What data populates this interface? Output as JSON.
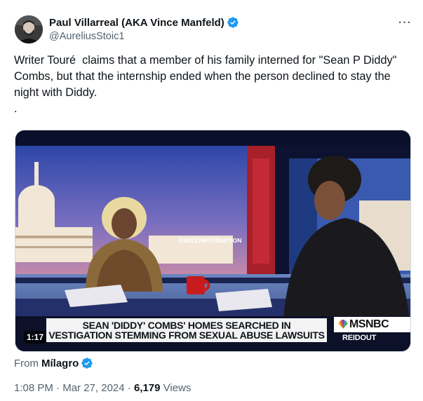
{
  "author": {
    "display_name": "Paul Villarreal (AKA Vince Manfeld)",
    "handle": "@AureliusStoic1",
    "verified_icon": "verified-badge-icon"
  },
  "more_icon": "more-options-icon",
  "tweet": {
    "text": "Writer Touré  claims that a member of his family interned for \"Sean P Diddy\" Combs, but that the internship ended when the person declined to stay the night with Diddy.\n."
  },
  "video": {
    "duration": "1:17",
    "watermark": "@MIZZINFORMATION",
    "chyron_line1": "SEAN 'DIDDY' COMBS' HOMES SEARCHED IN",
    "chyron_line2": "VESTIGATION STEMMING FROM SEXUAL ABUSE LAWSUITS",
    "network_logo": "MSNBC",
    "show_tag": "REIDOUT"
  },
  "source": {
    "label": "From",
    "name": "Mílagro"
  },
  "meta": {
    "time": "1:08 PM",
    "separator1": " · ",
    "date": "Mar 27, 2024",
    "separator2": " · ",
    "views_count": "6,179",
    "views_label": " Views"
  },
  "colors": {
    "verified_blue": "#1d9bf0",
    "secondary_text": "#536471",
    "primary_text": "#0f1419",
    "border": "#cfd9de"
  }
}
